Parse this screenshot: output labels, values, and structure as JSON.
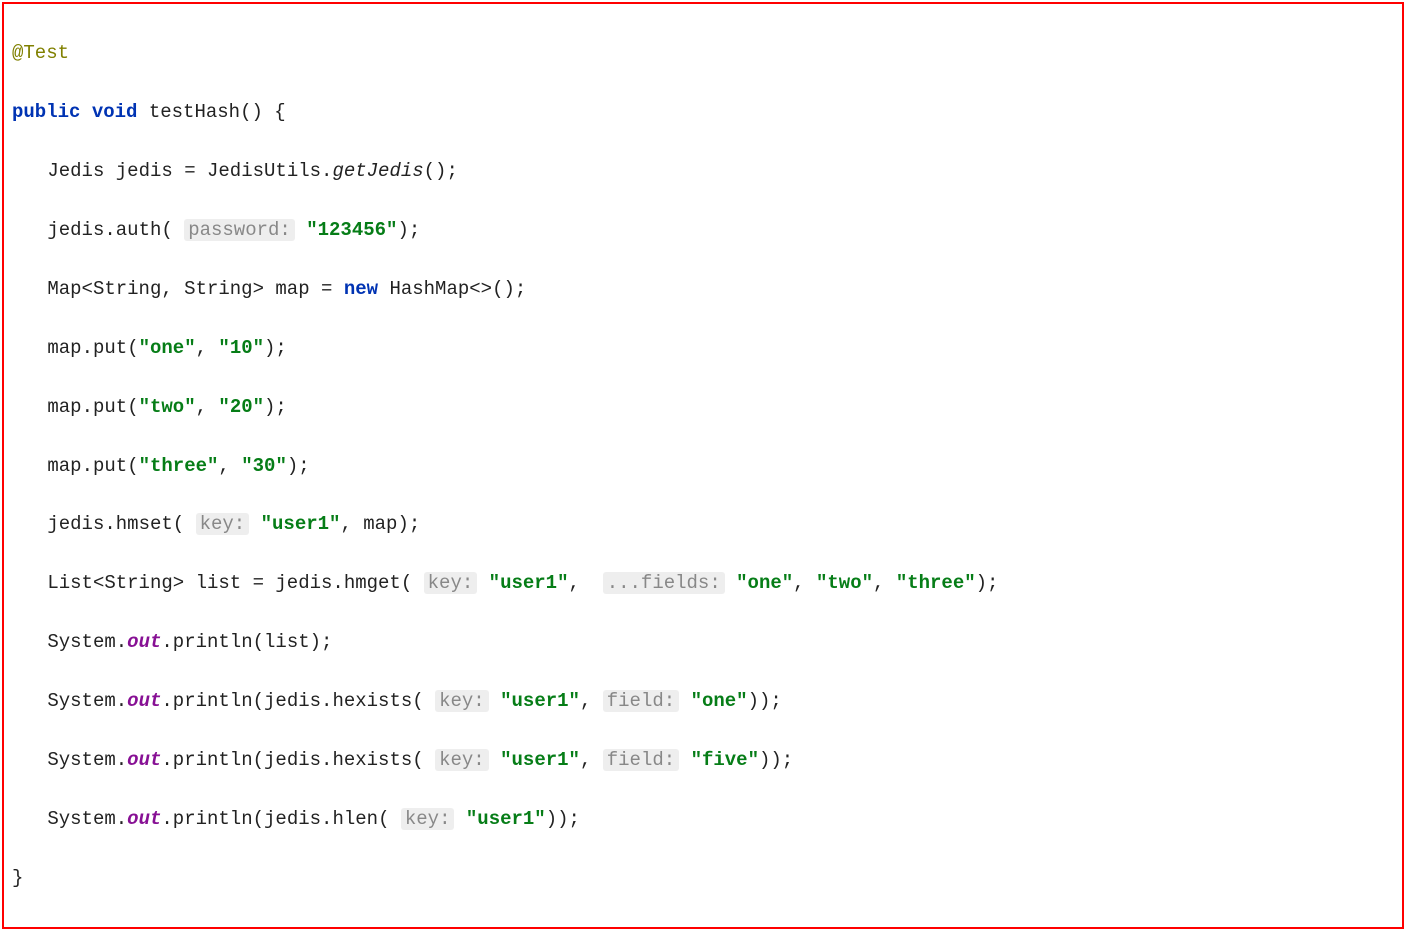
{
  "code": {
    "annot": "@Test",
    "kw_public": "public",
    "kw_void": "void",
    "method_name": "testHash",
    "jedis_decl_type": "Jedis",
    "jedis_var": "jedis",
    "jedisutils": "JedisUtils",
    "getjedis": "getJedis",
    "auth": "auth",
    "hint_password": "password:",
    "str_pw": "\"123456\"",
    "map_type_open": "Map<String, String>",
    "map_var": "map",
    "kw_new": "new",
    "hashmap": "HashMap<>()",
    "put": "put",
    "str_one": "\"one\"",
    "str_10": "\"10\"",
    "str_two": "\"two\"",
    "str_20": "\"20\"",
    "str_three": "\"three\"",
    "str_30": "\"30\"",
    "hmset": "hmset",
    "hint_key": "key:",
    "str_user1": "\"user1\"",
    "list_type": "List<String>",
    "list_var": "list",
    "hmget": "hmget",
    "hint_fields": "...fields:",
    "system": "System",
    "out": "out",
    "println": "println",
    "hexists": "hexists",
    "hint_field": "field:",
    "str_five": "\"five\"",
    "hlen": "hlen"
  }
}
